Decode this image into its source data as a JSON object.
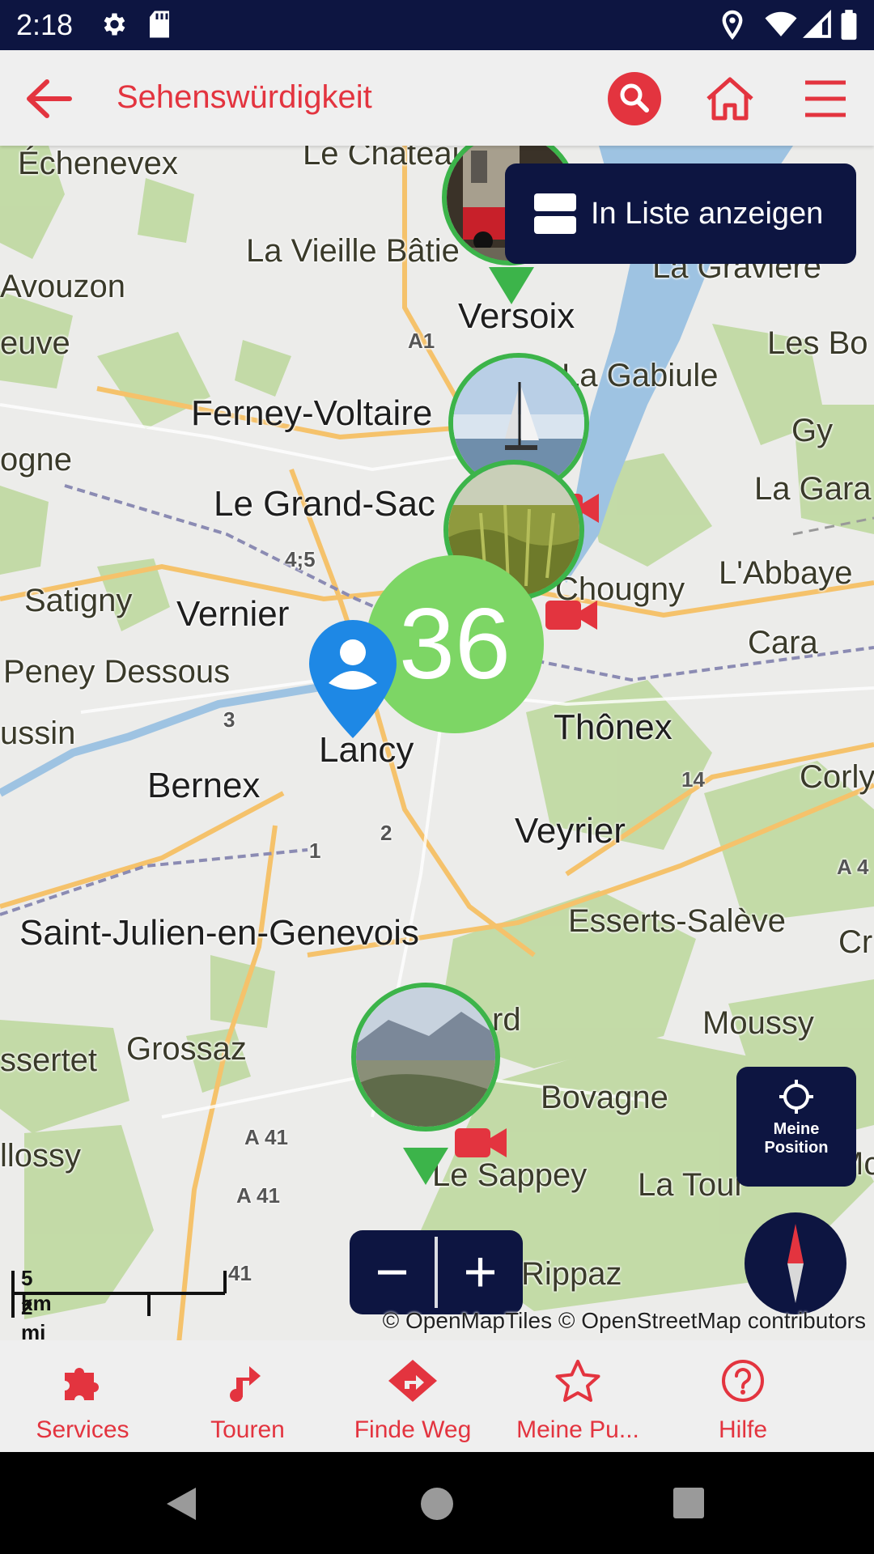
{
  "status_bar": {
    "time": "2:18",
    "icons": [
      "gear-icon",
      "sd-card-icon",
      "location-icon",
      "wifi-icon",
      "signal-icon",
      "battery-icon"
    ]
  },
  "app_bar": {
    "title": "Sehenswürdigkeit",
    "back_icon": "arrow-left-icon",
    "search_icon": "search-icon",
    "home_icon": "home-icon",
    "menu_icon": "menu-icon",
    "accent_color": "#e3343f"
  },
  "map": {
    "list_button": "In Liste anzeigen",
    "cluster_count": "36",
    "my_position": [
      "Meine",
      "Position"
    ],
    "zoom_out": "−",
    "zoom_in": "+",
    "scale": {
      "metric": "5 km",
      "imperial": "2 mi"
    },
    "attribution": "© OpenMapTiles © OpenStreetMap contributors",
    "places": {
      "echenevex": "Échenevex",
      "le_chateau": "Le Chateau",
      "la_vieille_batie": "La Vieille Bâtie",
      "la_graviere": "La Gravière",
      "avouzon": "Avouzon",
      "versoix": "Versoix",
      "euve": "euve",
      "a1": "A1",
      "les_bo": "Les Bo",
      "la_gabiule": "La Gabiule",
      "ferney": "Ferney-Voltaire",
      "gy": "Gy",
      "ogne": "ogne",
      "grand_sac": "Le Grand-Sac",
      "la_gara": "La Gara",
      "r45": "4;5",
      "chougny": "Chougny",
      "labbaye": "L'Abbaye",
      "satigny": "Satigny",
      "vernier": "Vernier",
      "cara": "Cara",
      "peney": "Peney Dessous",
      "r3": "3",
      "ussin": "ussin",
      "thonex": "Thônex",
      "lancy": "Lancy",
      "r14": "14",
      "corly": "Corly",
      "bernex": "Bernex",
      "r2": "2",
      "r1": "1",
      "veyrier": "Veyrier",
      "a4": "A 4",
      "saint_julien": "Saint-Julien-en-Genevois",
      "esserts": "Esserts-Salève",
      "cr": "Cr",
      "rd": "rd",
      "moussy": "Moussy",
      "grossaz": "Grossaz",
      "ssertet": "ssertet",
      "bovagne": "Bovagne",
      "a41a": "A 41",
      "llossy": "llossy",
      "a41b": "A 41",
      "le_sappey": "Le Sappey",
      "la_tour": "La Tour",
      "mc": "Mc",
      "a41c": "41",
      "rippaz": "Rippaz"
    }
  },
  "bottom_nav": [
    {
      "label": "Services",
      "icon": "puzzle-icon"
    },
    {
      "label": "Touren",
      "icon": "route-icon"
    },
    {
      "label": "Finde Weg",
      "icon": "directions-icon"
    },
    {
      "label": "Meine Pu...",
      "icon": "star-icon"
    },
    {
      "label": "Hilfe",
      "icon": "help-icon"
    }
  ]
}
